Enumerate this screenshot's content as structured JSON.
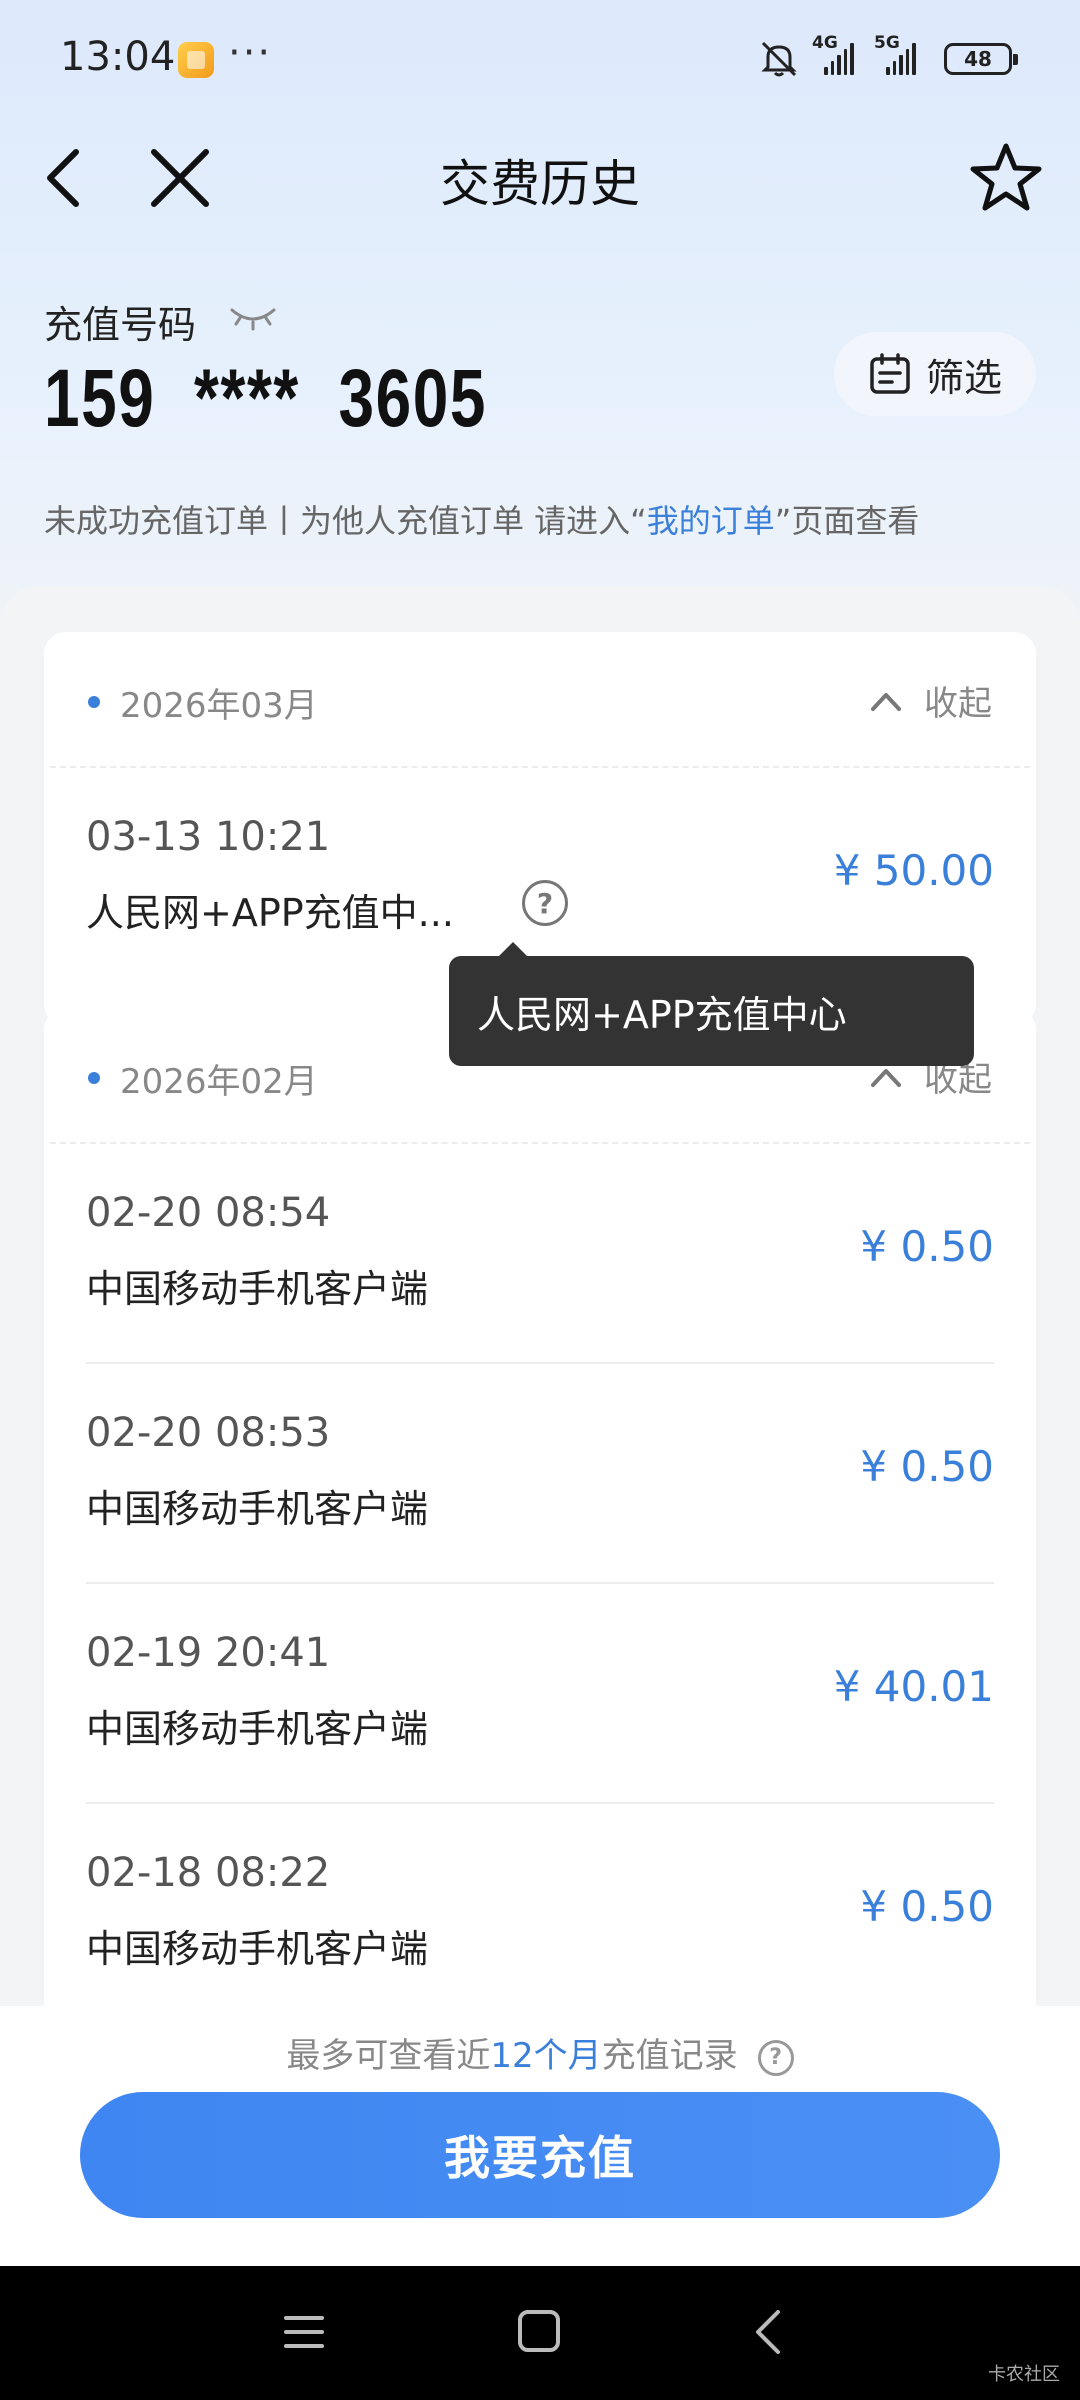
{
  "status_bar": {
    "time": "13:04",
    "dots": "···",
    "net1": "4G",
    "net2": "5G",
    "battery": "48"
  },
  "nav": {
    "title": "交费历史"
  },
  "account": {
    "label": "充值号码",
    "number": "159  ****  3605",
    "filter_label": "筛选"
  },
  "hint": {
    "prefix": "未成功充值订单丨为他人充值订单 请进入“",
    "link": "我的订单",
    "suffix": "”页面查看"
  },
  "months": [
    {
      "label": "2026年03月",
      "collapse_label": "收起",
      "records": [
        {
          "time": "03-13 10:21",
          "source": "人民网+APP充值中...",
          "amount": "¥ 50.00"
        }
      ]
    },
    {
      "label": "2026年02月",
      "collapse_label": "收起",
      "records": [
        {
          "time": "02-20 08:54",
          "source": "中国移动手机客户端",
          "amount": "¥ 0.50"
        },
        {
          "time": "02-20 08:53",
          "source": "中国移动手机客户端",
          "amount": "¥ 0.50"
        },
        {
          "time": "02-19 20:41",
          "source": "中国移动手机客户端",
          "amount": "¥ 40.01"
        },
        {
          "time": "02-18 08:22",
          "source": "中国移动手机客户端",
          "amount": "¥ 0.50"
        }
      ]
    }
  ],
  "tooltip": {
    "text": "人民网+APP充值中心"
  },
  "footer": {
    "note_prefix": "最多可查看近",
    "note_highlight": "12个月",
    "note_suffix": "充值记录",
    "qmark": "?",
    "button_label": "我要充值"
  },
  "watermark": "卡农社区",
  "colors": {
    "accent": "#3a7fd9",
    "button": "#4289f3",
    "tooltip_bg": "#333333"
  }
}
